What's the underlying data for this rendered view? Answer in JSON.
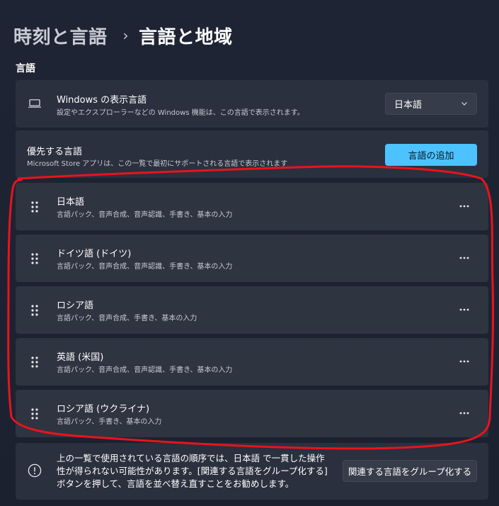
{
  "breadcrumb": {
    "parent": "時刻と言語",
    "separator": "›",
    "current": "言語と地域"
  },
  "section": {
    "title": "言語"
  },
  "display_language": {
    "icon": "monitor-icon",
    "title": "Windows の表示言語",
    "subtitle": "設定やエクスプローラーなどの Windows 機能は、この言語で表示されます。",
    "selected": "日本語"
  },
  "preferred": {
    "title": "優先する言語",
    "subtitle": "Microsoft Store アプリは、この一覧で最初にサポートされる言語で表示されます",
    "add_label": "言語の追加"
  },
  "languages": [
    {
      "name": "日本語",
      "features": "言語パック、音声合成、音声認識、手書き、基本の入力"
    },
    {
      "name": "ドイツ語 (ドイツ)",
      "features": "言語パック、音声合成、音声認識、手書き、基本の入力"
    },
    {
      "name": "ロシア語",
      "features": "言語パック、音声合成、手書き、基本の入力"
    },
    {
      "name": "英語 (米国)",
      "features": "言語パック、音声合成、音声認識、手書き、基本の入力"
    },
    {
      "name": "ロシア語 (ウクライナ)",
      "features": "言語パック、手書き、基本の入力"
    }
  ],
  "info": {
    "icon": "info-icon",
    "text": "上の一覧で使用されている言語の順序では、日本語 で一貫した操作性が得られない可能性があります。[関連する言語をグループ化する] ボタンを押して、言語を並べ替え直すことをお勧めします。",
    "button_label": "関連する言語をグループ化する"
  },
  "colors": {
    "accent": "#4cc2ff",
    "annotation": "#e8141c"
  }
}
